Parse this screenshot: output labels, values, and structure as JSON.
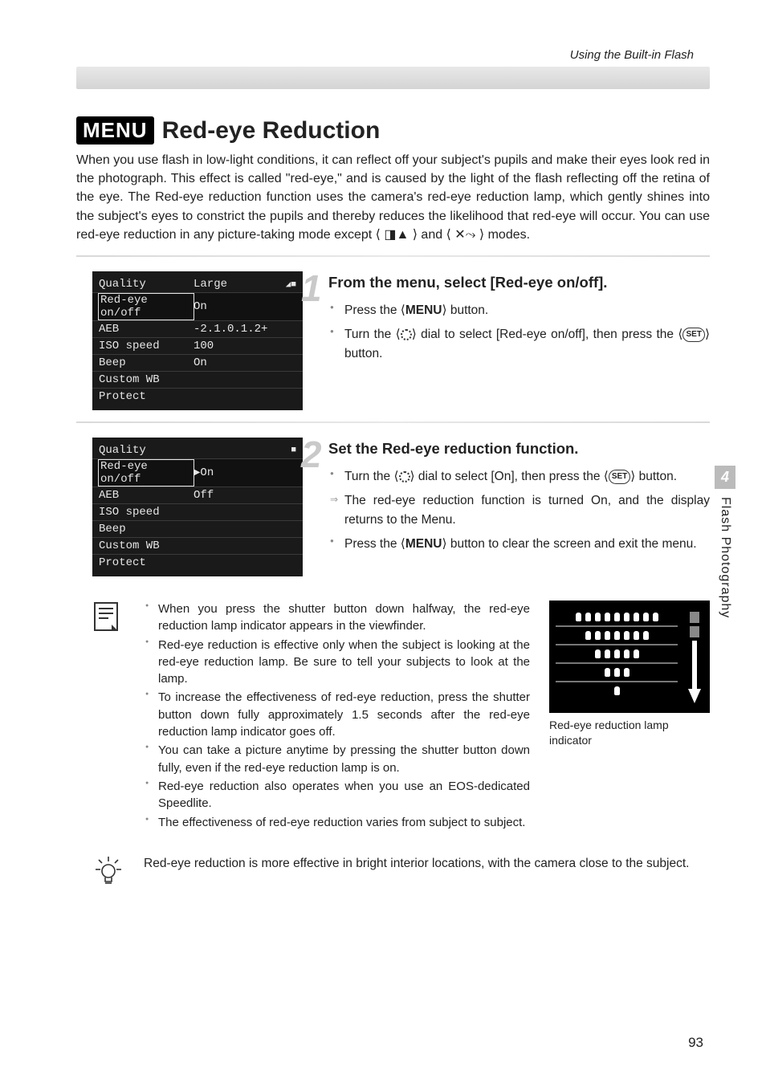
{
  "running_head": "Using the Built-in Flash",
  "menu_badge": "MENU",
  "title": "Red-eye Reduction",
  "intro": "When you use flash in low-light conditions, it can reflect off your subject's pupils and make their eyes look red in the photograph. This effect is called \"red-eye,\" and is caused by the light of the flash reflecting off the retina of the eye. The Red-eye reduction function uses the camera's red-eye reduction lamp, which gently shines into the subject's eyes to constrict the pupils and thereby reduces the likelihood that red-eye will occur. You can use red-eye reduction in any picture-taking mode except ⟨ ◨▲ ⟩ and ⟨ ✕⤳ ⟩ modes.",
  "lcd1": {
    "rows": [
      {
        "label": "Quality",
        "value": "Large",
        "mark": "◢■",
        "sel": false
      },
      {
        "label": "Red-eye on/off",
        "value": "On",
        "mark": "",
        "sel": true
      },
      {
        "label": "AEB",
        "value": "-2.1.0.1.2+",
        "mark": "",
        "sel": false
      },
      {
        "label": "ISO speed",
        "value": "100",
        "mark": "",
        "sel": false
      },
      {
        "label": "Beep",
        "value": "On",
        "mark": "",
        "sel": false
      },
      {
        "label": "Custom WB",
        "value": "",
        "mark": "",
        "sel": false
      },
      {
        "label": "Protect",
        "value": "",
        "mark": "",
        "sel": false
      }
    ]
  },
  "lcd2": {
    "rows": [
      {
        "label": "Quality",
        "value": "",
        "mark": "■",
        "sel": false
      },
      {
        "label": "Red-eye on/off",
        "value": "▶On",
        "mark": "",
        "sel": true
      },
      {
        "label": "AEB",
        "value": " Off",
        "mark": "",
        "sel": false
      },
      {
        "label": "ISO speed",
        "value": "",
        "mark": "",
        "sel": false
      },
      {
        "label": "Beep",
        "value": "",
        "mark": "",
        "sel": false
      },
      {
        "label": "Custom WB",
        "value": "",
        "mark": "",
        "sel": false
      },
      {
        "label": "Protect",
        "value": "",
        "mark": "",
        "sel": false
      }
    ]
  },
  "step1": {
    "num": "1",
    "title": "From the menu, select [Red-eye on/off].",
    "items": [
      "Press the ⟨MENU⟩ button.",
      "Turn the ⟨○⟩ dial to select [Red-eye on/off], then press the ⟨SET⟩ button."
    ]
  },
  "step2": {
    "num": "2",
    "title": "Set the Red-eye reduction function.",
    "items": [
      {
        "t": "Turn the ⟨○⟩ dial to select [On], then press the ⟨SET⟩ button.",
        "a": false
      },
      {
        "t": "The red-eye reduction function is turned On, and the display returns to the Menu.",
        "a": true
      },
      {
        "t": "Press the ⟨MENU⟩ button to clear the screen and exit the menu.",
        "a": false
      }
    ]
  },
  "sidebar": {
    "num": "4",
    "label": "Flash Photography"
  },
  "notes": [
    "When you press the shutter button down halfway, the red-eye reduction lamp indicator appears in the viewfinder.",
    "Red-eye reduction is effective only when the subject is looking at the red-eye reduction lamp. Be sure to tell your subjects to look at the lamp.",
    "To increase the effectiveness of red-eye reduction, press the shutter button down fully approximately 1.5 seconds after the red-eye reduction lamp indicator goes off.",
    "You can take a picture anytime by pressing the shutter button down fully, even if the red-eye reduction lamp is on.",
    "Red-eye reduction also operates when you use an EOS-dedicated Speedlite.",
    "The effectiveness of red-eye reduction varies from subject to subject."
  ],
  "indicator_caption": "Red-eye reduction lamp indicator",
  "indicator_rows": [
    9,
    7,
    5,
    3,
    1
  ],
  "tip": "Red-eye reduction is more effective in bright interior locations, with the camera close to the subject.",
  "page_number": "93"
}
